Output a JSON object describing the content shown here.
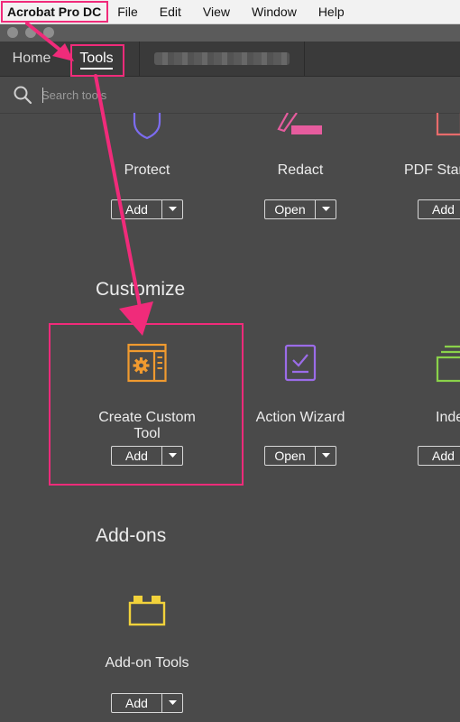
{
  "menubar": {
    "app_name": "Acrobat Pro DC",
    "items": [
      "File",
      "Edit",
      "View",
      "Window",
      "Help"
    ]
  },
  "tabs": {
    "home": "Home",
    "tools": "Tools"
  },
  "search": {
    "placeholder": "Search tools"
  },
  "sections": {
    "customize": "Customize",
    "addons": "Add-ons"
  },
  "tools_row1": [
    {
      "label": "Protect",
      "button": "Add",
      "icon": "shield-icon",
      "color": "#7c6cf0"
    },
    {
      "label": "Redact",
      "button": "Open",
      "icon": "redact-marker-icon",
      "color": "#e65c9e"
    },
    {
      "label": "PDF Stan",
      "button": "Add",
      "icon": "pdf-standards-icon",
      "color": "#e86b6b"
    }
  ],
  "tools_customize": [
    {
      "label": "Create Custom Tool",
      "button": "Add",
      "icon": "custom-tool-gear-icon",
      "color": "#f09a2f"
    },
    {
      "label": "Action Wizard",
      "button": "Open",
      "icon": "action-wizard-icon",
      "color": "#9b6ce8"
    },
    {
      "label": "Inde",
      "button": "Add",
      "icon": "index-icon",
      "color": "#8ad24a"
    }
  ],
  "tools_addons": [
    {
      "label": "Add-on Tools",
      "button": "Add",
      "icon": "addon-blocks-icon",
      "color": "#f2d23b"
    }
  ],
  "annotation_color": "#f02b7a"
}
